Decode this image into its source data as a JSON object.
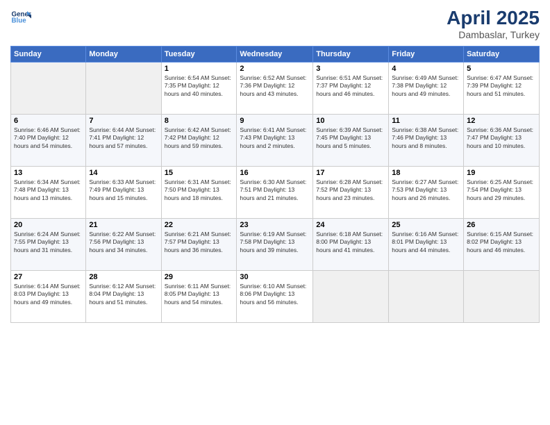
{
  "logo": {
    "line1": "General",
    "line2": "Blue"
  },
  "title": "April 2025",
  "subtitle": "Dambaslar, Turkey",
  "weekdays": [
    "Sunday",
    "Monday",
    "Tuesday",
    "Wednesday",
    "Thursday",
    "Friday",
    "Saturday"
  ],
  "weeks": [
    [
      {
        "day": "",
        "info": ""
      },
      {
        "day": "",
        "info": ""
      },
      {
        "day": "1",
        "info": "Sunrise: 6:54 AM\nSunset: 7:35 PM\nDaylight: 12 hours and 40 minutes."
      },
      {
        "day": "2",
        "info": "Sunrise: 6:52 AM\nSunset: 7:36 PM\nDaylight: 12 hours and 43 minutes."
      },
      {
        "day": "3",
        "info": "Sunrise: 6:51 AM\nSunset: 7:37 PM\nDaylight: 12 hours and 46 minutes."
      },
      {
        "day": "4",
        "info": "Sunrise: 6:49 AM\nSunset: 7:38 PM\nDaylight: 12 hours and 49 minutes."
      },
      {
        "day": "5",
        "info": "Sunrise: 6:47 AM\nSunset: 7:39 PM\nDaylight: 12 hours and 51 minutes."
      }
    ],
    [
      {
        "day": "6",
        "info": "Sunrise: 6:46 AM\nSunset: 7:40 PM\nDaylight: 12 hours and 54 minutes."
      },
      {
        "day": "7",
        "info": "Sunrise: 6:44 AM\nSunset: 7:41 PM\nDaylight: 12 hours and 57 minutes."
      },
      {
        "day": "8",
        "info": "Sunrise: 6:42 AM\nSunset: 7:42 PM\nDaylight: 12 hours and 59 minutes."
      },
      {
        "day": "9",
        "info": "Sunrise: 6:41 AM\nSunset: 7:43 PM\nDaylight: 13 hours and 2 minutes."
      },
      {
        "day": "10",
        "info": "Sunrise: 6:39 AM\nSunset: 7:45 PM\nDaylight: 13 hours and 5 minutes."
      },
      {
        "day": "11",
        "info": "Sunrise: 6:38 AM\nSunset: 7:46 PM\nDaylight: 13 hours and 8 minutes."
      },
      {
        "day": "12",
        "info": "Sunrise: 6:36 AM\nSunset: 7:47 PM\nDaylight: 13 hours and 10 minutes."
      }
    ],
    [
      {
        "day": "13",
        "info": "Sunrise: 6:34 AM\nSunset: 7:48 PM\nDaylight: 13 hours and 13 minutes."
      },
      {
        "day": "14",
        "info": "Sunrise: 6:33 AM\nSunset: 7:49 PM\nDaylight: 13 hours and 15 minutes."
      },
      {
        "day": "15",
        "info": "Sunrise: 6:31 AM\nSunset: 7:50 PM\nDaylight: 13 hours and 18 minutes."
      },
      {
        "day": "16",
        "info": "Sunrise: 6:30 AM\nSunset: 7:51 PM\nDaylight: 13 hours and 21 minutes."
      },
      {
        "day": "17",
        "info": "Sunrise: 6:28 AM\nSunset: 7:52 PM\nDaylight: 13 hours and 23 minutes."
      },
      {
        "day": "18",
        "info": "Sunrise: 6:27 AM\nSunset: 7:53 PM\nDaylight: 13 hours and 26 minutes."
      },
      {
        "day": "19",
        "info": "Sunrise: 6:25 AM\nSunset: 7:54 PM\nDaylight: 13 hours and 29 minutes."
      }
    ],
    [
      {
        "day": "20",
        "info": "Sunrise: 6:24 AM\nSunset: 7:55 PM\nDaylight: 13 hours and 31 minutes."
      },
      {
        "day": "21",
        "info": "Sunrise: 6:22 AM\nSunset: 7:56 PM\nDaylight: 13 hours and 34 minutes."
      },
      {
        "day": "22",
        "info": "Sunrise: 6:21 AM\nSunset: 7:57 PM\nDaylight: 13 hours and 36 minutes."
      },
      {
        "day": "23",
        "info": "Sunrise: 6:19 AM\nSunset: 7:58 PM\nDaylight: 13 hours and 39 minutes."
      },
      {
        "day": "24",
        "info": "Sunrise: 6:18 AM\nSunset: 8:00 PM\nDaylight: 13 hours and 41 minutes."
      },
      {
        "day": "25",
        "info": "Sunrise: 6:16 AM\nSunset: 8:01 PM\nDaylight: 13 hours and 44 minutes."
      },
      {
        "day": "26",
        "info": "Sunrise: 6:15 AM\nSunset: 8:02 PM\nDaylight: 13 hours and 46 minutes."
      }
    ],
    [
      {
        "day": "27",
        "info": "Sunrise: 6:14 AM\nSunset: 8:03 PM\nDaylight: 13 hours and 49 minutes."
      },
      {
        "day": "28",
        "info": "Sunrise: 6:12 AM\nSunset: 8:04 PM\nDaylight: 13 hours and 51 minutes."
      },
      {
        "day": "29",
        "info": "Sunrise: 6:11 AM\nSunset: 8:05 PM\nDaylight: 13 hours and 54 minutes."
      },
      {
        "day": "30",
        "info": "Sunrise: 6:10 AM\nSunset: 8:06 PM\nDaylight: 13 hours and 56 minutes."
      },
      {
        "day": "",
        "info": ""
      },
      {
        "day": "",
        "info": ""
      },
      {
        "day": "",
        "info": ""
      }
    ]
  ]
}
